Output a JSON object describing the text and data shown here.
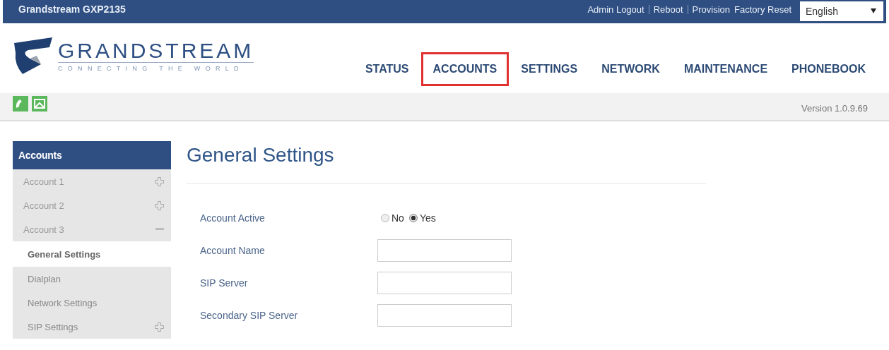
{
  "top_bar": {
    "title": "Grandstream GXP2135",
    "links": [
      "Admin Logout",
      "Reboot",
      "Provision",
      "Factory Reset"
    ],
    "language": "English"
  },
  "logo": {
    "name": "GRANDSTREAM",
    "tagline": "CONNECTING THE WORLD"
  },
  "nav": [
    {
      "label": "STATUS",
      "selected": false
    },
    {
      "label": "ACCOUNTS",
      "selected": true
    },
    {
      "label": "SETTINGS",
      "selected": false
    },
    {
      "label": "NETWORK",
      "selected": false
    },
    {
      "label": "MAINTENANCE",
      "selected": false
    },
    {
      "label": "PHONEBOOK",
      "selected": false
    }
  ],
  "version": "Version 1.0.9.69",
  "sidebar": {
    "title": "Accounts",
    "items": [
      {
        "label": "Account 1",
        "expanded": false
      },
      {
        "label": "Account 2",
        "expanded": false
      },
      {
        "label": "Account 3",
        "expanded": true,
        "children": [
          {
            "label": "General Settings",
            "selected": true
          },
          {
            "label": "Dialplan",
            "selected": false
          },
          {
            "label": "Network Settings",
            "selected": false
          },
          {
            "label": "SIP Settings",
            "selected": false,
            "expanded": false
          }
        ]
      }
    ]
  },
  "page_title": "General Settings",
  "form": [
    {
      "kind": "radio",
      "label": "Account Active",
      "options": [
        {
          "label": "No",
          "selected": false
        },
        {
          "label": "Yes",
          "selected": true
        }
      ]
    },
    {
      "kind": "text",
      "label": "Account Name"
    },
    {
      "kind": "text",
      "label": "SIP Server"
    },
    {
      "kind": "text",
      "label": "Secondary SIP Server"
    }
  ]
}
